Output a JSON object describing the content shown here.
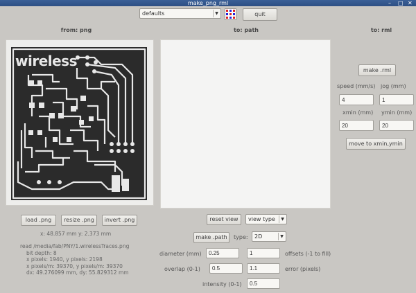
{
  "window": {
    "title": "make_png_rml"
  },
  "toolbar": {
    "preset": "defaults",
    "quit_label": "quit"
  },
  "columns": {
    "from": "from: png",
    "to_path": "to: path",
    "to_rml": "to: rml"
  },
  "image": {
    "logo_text": "wireless"
  },
  "png_buttons": {
    "load": "load .png",
    "resize": "resize .png",
    "invert": "invert .png"
  },
  "png_info": {
    "coords": "x: 48.857 mm  y: 2.373 mm",
    "file": "read /media/fab/PNY/1.wirelessTraces.png",
    "bit_depth": "bit depth: 8",
    "pixels": "x pixels: 1940, y pixels: 2198",
    "pixels_per_m": "x pixels/m: 39370, y pixels/m: 39370",
    "dims": "dx: 49.276099 mm, dy: 55.829312 mm"
  },
  "path_controls": {
    "reset_view": "reset view",
    "view_type": "view type",
    "make_path": "make .path",
    "type_label": "type:",
    "type_value": "2D",
    "diameter_label": "diameter (mm)",
    "diameter_value": "0.25",
    "offsets_value": "1",
    "offsets_label": "offsets (-1 to fill)",
    "overlap_label": "overlap (0-1)",
    "overlap_value": "0.5",
    "error_value": "1.1",
    "error_label": "error (pixels)",
    "intensity_label": "intensity (0-1)",
    "intensity_value": "0.5"
  },
  "rml_controls": {
    "make_rml": "make .rml",
    "speed_label": "speed (mm/s)",
    "jog_label": "jog (mm)",
    "speed_value": "4",
    "jog_value": "1",
    "xmin_label": "xmin (mm)",
    "ymin_label": "ymin (mm)",
    "xmin_value": "20",
    "ymin_value": "20",
    "move_label": "move to xmin,ymin"
  },
  "colors": {
    "titlebar": "#2d4f84",
    "pcb_background": "#2b2b2b",
    "trace": "#e8e8e8"
  }
}
